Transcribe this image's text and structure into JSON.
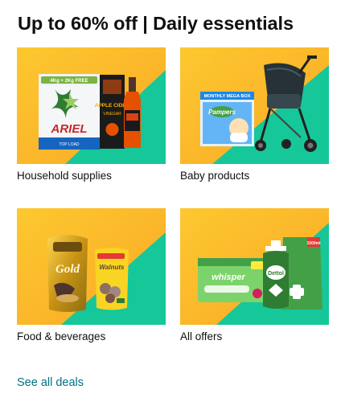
{
  "card": {
    "title": "Up to 60% off | Daily essentials",
    "see_all_label": "See all deals"
  },
  "tiles": [
    {
      "label": "Household supplies",
      "image": "household-supplies-product-image"
    },
    {
      "label": "Baby products",
      "image": "baby-products-product-image"
    },
    {
      "label": "Food & beverages",
      "image": "food-beverages-product-image"
    },
    {
      "label": "All offers",
      "image": "all-offers-product-image"
    }
  ],
  "product_text": {
    "ariel_promo": "4Kg + 2Kg FREE",
    "ariel_brand": "ARIEL",
    "ariel_sub": "TOP LOAD",
    "cider_brand": "APPLE CIDER",
    "cider_sub": "VINEGAR",
    "pampers_banner": "MONTHLY MEGA BOX",
    "pampers_brand": "Pampers",
    "gold_brand": "Gold",
    "walnuts_brand": "Walnuts",
    "whisper_brand": "whisper",
    "dettol_brand": "Dettol",
    "dettol_size": "1500ml"
  },
  "colors": {
    "banner_yellow": "#fbbf24",
    "banner_green": "#16c79a",
    "link": "#007185",
    "text": "#0f1111"
  }
}
